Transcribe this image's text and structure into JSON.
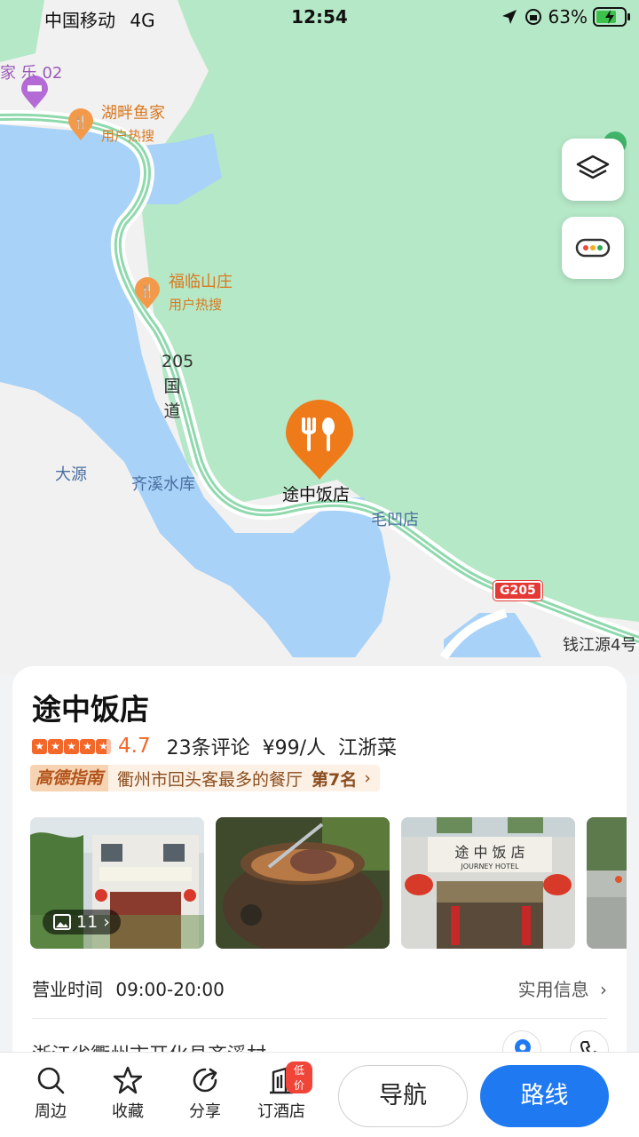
{
  "status_bar": {
    "carrier": "中国移动",
    "network": "4G",
    "time": "12:54",
    "battery": "63%"
  },
  "map": {
    "pois": [
      {
        "name": "湖畔鱼家",
        "sub": "用户热搜"
      },
      {
        "name": "福临山庄",
        "sub": "用户热搜"
      }
    ],
    "places": [
      "大源",
      "齐溪水库",
      "毛凹店",
      "钱江源4号"
    ],
    "road_name": "205国道",
    "road_badge": "G205",
    "selected_marker_label": "途中饭店",
    "edge_text": "家 乐 02",
    "buttons": {
      "layers_icon": "layers-icon",
      "more_icon": "more-dots-icon"
    }
  },
  "card": {
    "title": "途中饭店",
    "rating": "4.7",
    "reviews": "23条评论",
    "price": "¥99/人",
    "cuisine": "江浙菜",
    "guide": {
      "badge": "高德指南",
      "text": "衢州市回头客最多的餐厅",
      "rank": "第7名"
    },
    "photo_count": "11",
    "hours_label": "营业时间",
    "hours": "09:00-20:00",
    "info_link": "实用信息",
    "address_partial": "浙江省衢州市开化县齐溪村"
  },
  "bottom_bar": {
    "tabs": [
      {
        "label": "周边",
        "icon": "search-icon"
      },
      {
        "label": "收藏",
        "icon": "star-icon"
      },
      {
        "label": "分享",
        "icon": "share-icon"
      },
      {
        "label": "订酒店",
        "icon": "hotel-icon",
        "badge": "低价"
      }
    ],
    "navigate_label": "导航",
    "route_label": "路线"
  },
  "colors": {
    "accent": "#1f7af2",
    "rating": "#f2672a",
    "map_green": "#b5e8c7",
    "map_water": "#a8d2f7"
  }
}
